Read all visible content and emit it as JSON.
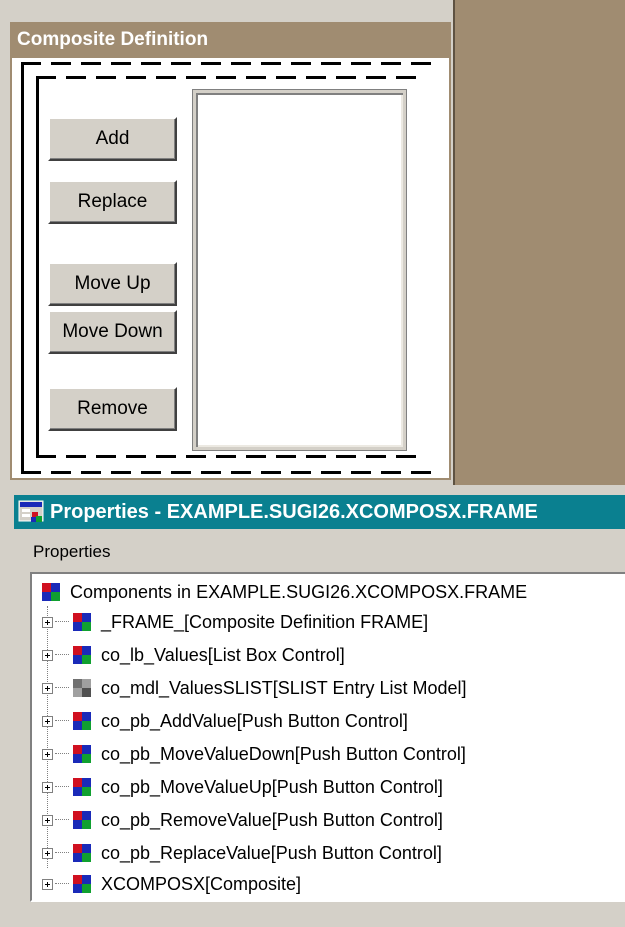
{
  "frame": {
    "title": "Composite Definition",
    "buttons": {
      "add": "Add",
      "replace": "Replace",
      "move_up": "Move Up",
      "move_down": "Move Down",
      "remove": "Remove"
    }
  },
  "properties_window": {
    "title": "Properties - EXAMPLE.SUGI26.XCOMPOSX.FRAME",
    "group_label": "Properties",
    "tree": {
      "root": "Components in EXAMPLE.SUGI26.XCOMPOSX.FRAME",
      "items": [
        {
          "label": "_FRAME_[Composite Definition FRAME]",
          "icon": "component-icon"
        },
        {
          "label": "co_lb_Values[List Box Control]",
          "icon": "component-icon"
        },
        {
          "label": "co_mdl_ValuesSLIST[SLIST Entry List Model]",
          "icon": "model-icon"
        },
        {
          "label": "co_pb_AddValue[Push Button Control]",
          "icon": "component-icon"
        },
        {
          "label": "co_pb_MoveValueDown[Push Button Control]",
          "icon": "component-icon"
        },
        {
          "label": "co_pb_MoveValueUp[Push Button Control]",
          "icon": "component-icon"
        },
        {
          "label": "co_pb_RemoveValue[Push Button Control]",
          "icon": "component-icon"
        },
        {
          "label": "co_pb_ReplaceValue[Push Button Control]",
          "icon": "component-icon"
        },
        {
          "label": "XCOMPOSX[Composite]",
          "icon": "component-icon"
        }
      ]
    }
  },
  "colors": {
    "frame_title_bg": "#a08c71",
    "props_title_bg": "#0a8090",
    "dialog_bg": "#d4d0c8"
  }
}
